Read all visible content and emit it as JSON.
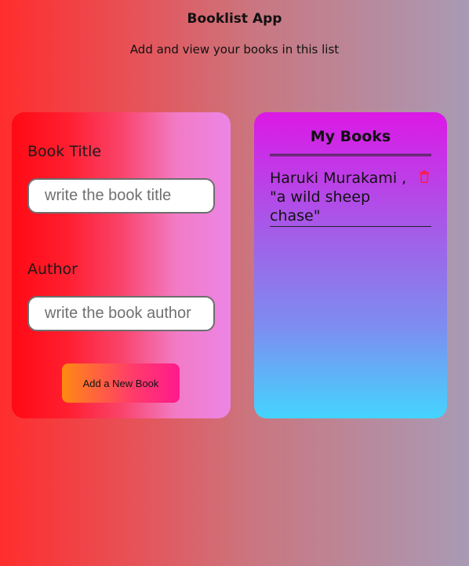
{
  "header": {
    "title": "Booklist App",
    "subtitle": "Add and view your books in this list"
  },
  "form": {
    "title_label": "Book Title",
    "title_placeholder": "write the book title",
    "author_label": "Author",
    "author_placeholder": "write the book author",
    "add_button_label": "Add a New Book"
  },
  "books": {
    "heading": "My Books",
    "items": [
      {
        "display": "Haruki Murakami , \"a wild sheep chase\"",
        "author": "Haruki Murakami",
        "title": "a wild sheep chase",
        "delete_icon": "trash-icon"
      }
    ]
  },
  "colors": {
    "delete_icon": "#ff1a4a",
    "button_gradient_start": "#ff8a12",
    "button_gradient_end": "#ff1a8c"
  }
}
